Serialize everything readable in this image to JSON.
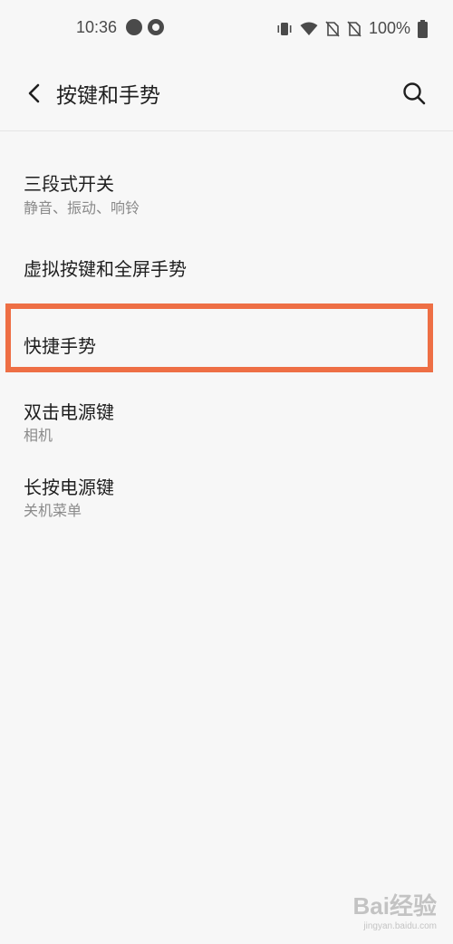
{
  "status_bar": {
    "time": "10:36",
    "battery": "100%"
  },
  "header": {
    "title": "按键和手势"
  },
  "items": [
    {
      "title": "三段式开关",
      "subtitle": "静音、振动、响铃"
    },
    {
      "title": "虚拟按键和全屏手势",
      "subtitle": ""
    },
    {
      "title": "快捷手势",
      "subtitle": ""
    },
    {
      "title": "双击电源键",
      "subtitle": "相机"
    },
    {
      "title": "长按电源键",
      "subtitle": "关机菜单"
    }
  ],
  "highlight_color": "#ee6f45",
  "watermark": {
    "main": "Bai经验",
    "sub": "jingyan.baidu.com"
  }
}
